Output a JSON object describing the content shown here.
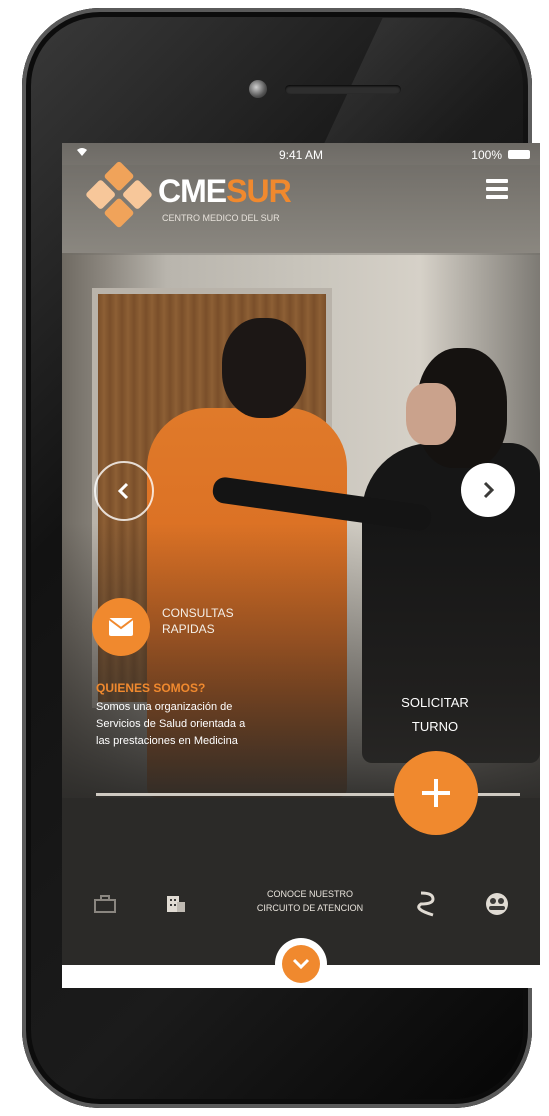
{
  "status_bar": {
    "time": "9:41 AM",
    "battery": "100%"
  },
  "header": {
    "brand_part1": "CME",
    "brand_part2": "SUR",
    "brand_subtitle": "CENTRO MEDICO DEL SUR"
  },
  "contact": {
    "label_line1": "CONSULTAS",
    "label_line2": "RAPIDAS"
  },
  "about": {
    "title": "QUIENES SOMOS?",
    "line1": "Somos una organización de",
    "line2": "Servicios de Salud orientada a",
    "line3": "las prestaciones en Medicina"
  },
  "turno": {
    "line1": "SOLICITAR",
    "line2": "TURNO"
  },
  "nav": {
    "circuit_line1": "CONOCE NUESTRO",
    "circuit_line2": "CIRCUITO DE ATENCION"
  },
  "colors": {
    "accent": "#f0892e",
    "screen_bg": "#2b2a28",
    "text": "#ffffff"
  },
  "icons": [
    "wifi-icon",
    "battery-icon",
    "logo-icon",
    "menu-icon",
    "chevron-left-icon",
    "chevron-right-icon",
    "mail-icon",
    "plus-icon",
    "briefcase-icon",
    "building-icon",
    "route-icon",
    "people-icon",
    "chevron-down-icon"
  ]
}
